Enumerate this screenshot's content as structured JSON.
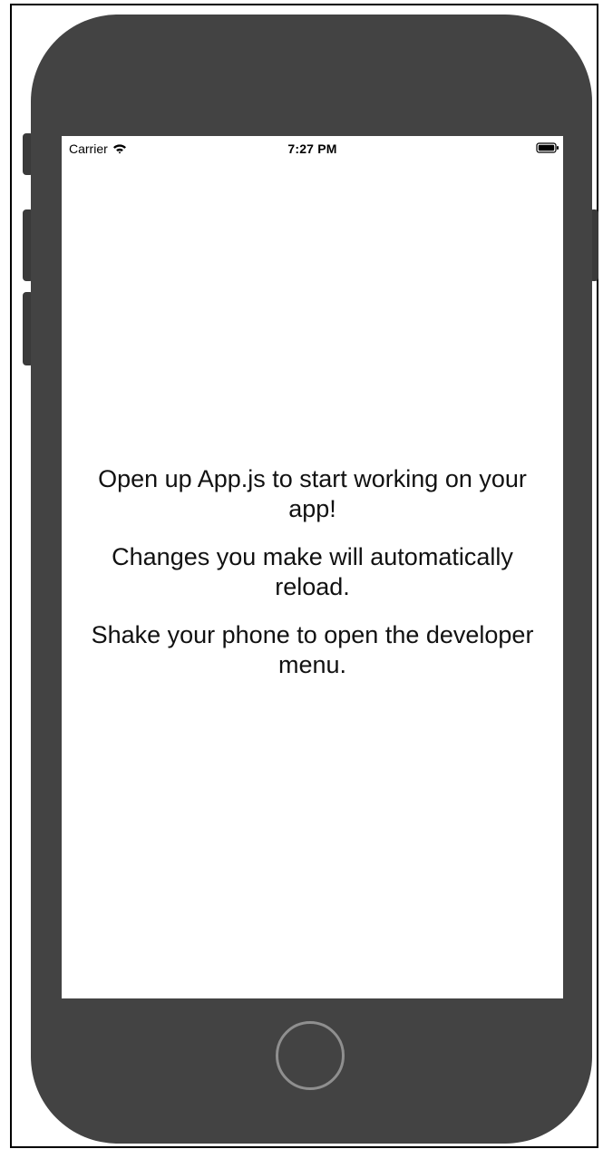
{
  "device": {
    "body_color": "#434343",
    "screen_color": "#ffffff",
    "home_button_ring_color": "#8f8f8f"
  },
  "status_bar": {
    "carrier": "Carrier",
    "time": "7:27 PM",
    "icons": [
      "wifi-icon",
      "battery-icon"
    ]
  },
  "app": {
    "lines": [
      "Open up App.js to start working on your app!",
      "Changes you make will automatically reload.",
      "Shake your phone to open the developer menu."
    ]
  }
}
